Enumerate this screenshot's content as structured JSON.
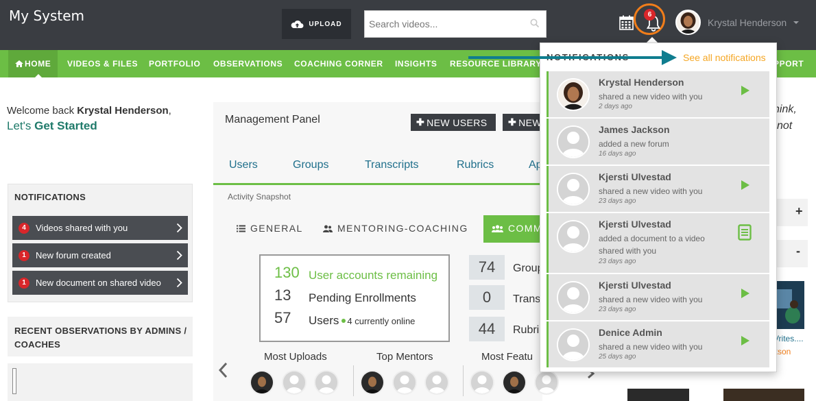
{
  "header": {
    "brand": "My System",
    "upload_label": "UPLOAD",
    "search_placeholder": "Search videos...",
    "notification_count": "6",
    "user_name": "Krystal Henderson"
  },
  "nav": {
    "items": [
      {
        "label": "HOME"
      },
      {
        "label": "VIDEOS & FILES"
      },
      {
        "label": "PORTFOLIO"
      },
      {
        "label": "OBSERVATIONS"
      },
      {
        "label": "COACHING CORNER"
      },
      {
        "label": "INSIGHTS"
      },
      {
        "label": "RESOURCE LIBRARY"
      },
      {
        "label": "PPORT"
      }
    ]
  },
  "welcome": {
    "prefix": "Welcome back ",
    "name": "Krystal Henderson",
    "suffix": ",",
    "lets": "Let's ",
    "get_started": "Get Started"
  },
  "left_notifications": {
    "title": "NOTIFICATIONS",
    "items": [
      {
        "count": "4",
        "label": "Videos shared with you"
      },
      {
        "count": "1",
        "label": "New forum created"
      },
      {
        "count": "1",
        "label": "New document on shared video"
      }
    ]
  },
  "recent_observations": {
    "title": "RECENT OBSERVATIONS BY ADMINS / COACHES"
  },
  "management": {
    "title": "Management Panel",
    "new_users_label": "NEW USERS",
    "new_label": "NEW",
    "tabs": [
      "Users",
      "Groups",
      "Transcripts",
      "Rubrics",
      "Ap"
    ],
    "snapshot_label": "Activity Snapshot",
    "subtabs": [
      "GENERAL",
      "MENTORING-COACHING",
      "COMM"
    ],
    "stats": [
      {
        "value": "130",
        "label": "User accounts remaining"
      },
      {
        "value": "13",
        "label": "Pending Enrollments"
      },
      {
        "value": "57",
        "label": "Users",
        "extra": "4 currently online"
      }
    ],
    "counts": [
      {
        "value": "74",
        "label": "Group"
      },
      {
        "value": "0",
        "label": "Trans"
      },
      {
        "value": "44",
        "label": "Rubri"
      }
    ],
    "mini_sections": [
      "Most Uploads",
      "Top Mentors",
      "Most Featu"
    ]
  },
  "right_fragments": {
    "line1": "hink,",
    "line2": "not",
    "plus": "+",
    "minus": "-",
    "link1": "Vrites....",
    "link2": "kson"
  },
  "dropdown": {
    "title": "NOTIFICATIONS",
    "see_all": "See all notifications",
    "items": [
      {
        "name": "Krystal Henderson",
        "action": "shared a new video with you",
        "time": "2 days ago",
        "icon": "play-icon"
      },
      {
        "name": "James Jackson",
        "action": "added a new forum",
        "time": "16 days ago",
        "icon": ""
      },
      {
        "name": "Kjersti Ulvestad",
        "action": "shared a new video with you",
        "time": "23 days ago",
        "icon": "play-icon"
      },
      {
        "name": "Kjersti Ulvestad",
        "action": "added a document to a video shared with you",
        "time": "23 days ago",
        "icon": "document-icon"
      },
      {
        "name": "Kjersti Ulvestad",
        "action": "shared a new video with you",
        "time": "23 days ago",
        "icon": "play-icon"
      },
      {
        "name": "Denice Admin",
        "action": "shared a new video with you",
        "time": "25 days ago",
        "icon": "play-icon"
      }
    ]
  },
  "colors": {
    "topbar": "#3a3d42",
    "nav_green": "#6cbe45",
    "accent_orange": "#f07d1a",
    "see_all_orange": "#f5a623",
    "badge_red": "#d9262a",
    "annotation_teal": "#0f7d8f"
  }
}
